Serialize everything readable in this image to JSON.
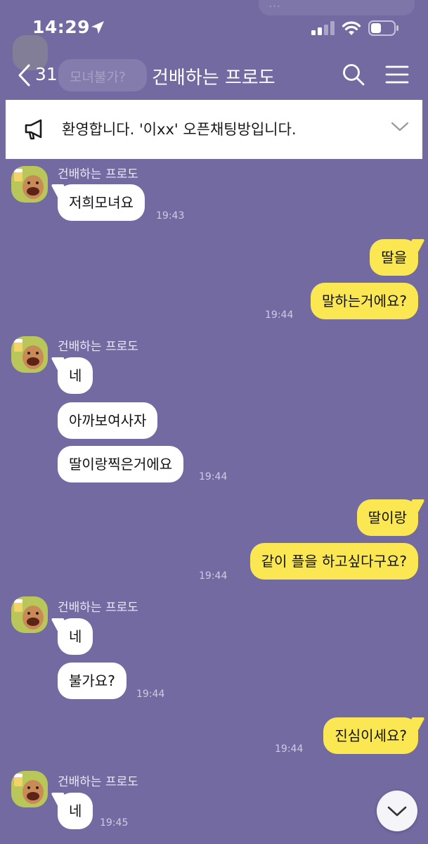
{
  "status_bar": {
    "time": "14:29"
  },
  "ghost": {
    "top_text": "...",
    "bubble_text": "모녀불가?"
  },
  "nav": {
    "back_count": "31",
    "title": "건배하는 프로도"
  },
  "notice": {
    "text": "환영합니다. '이xx' 오픈채팅방입니다."
  },
  "colors": {
    "background": "#736aa2",
    "my_bubble": "#fae751",
    "other_bubble": "#ffffff",
    "avatar_bg": "#b9c65a"
  },
  "messages": [
    {
      "sender": "건배하는 프로도",
      "bubbles": [
        "저희모녀요"
      ],
      "time": "19:43"
    },
    {
      "me": true,
      "bubbles": [
        "딸을",
        "말하는거에요?"
      ],
      "time": "19:44"
    },
    {
      "sender": "건배하는 프로도",
      "bubbles": [
        "네",
        "아까보여사자",
        "딸이랑찍은거에요"
      ],
      "time": "19:44"
    },
    {
      "me": true,
      "bubbles": [
        "딸이랑",
        "같이 플을 하고싶다구요?"
      ],
      "time": "19:44"
    },
    {
      "sender": "건배하는 프로도",
      "bubbles": [
        "네",
        "불가요?"
      ],
      "time": "19:44"
    },
    {
      "me": true,
      "bubbles": [
        "진심이세요?"
      ],
      "time": "19:44"
    },
    {
      "sender": "건배하는 프로도",
      "bubbles": [
        "네"
      ],
      "time": "19:45"
    }
  ]
}
